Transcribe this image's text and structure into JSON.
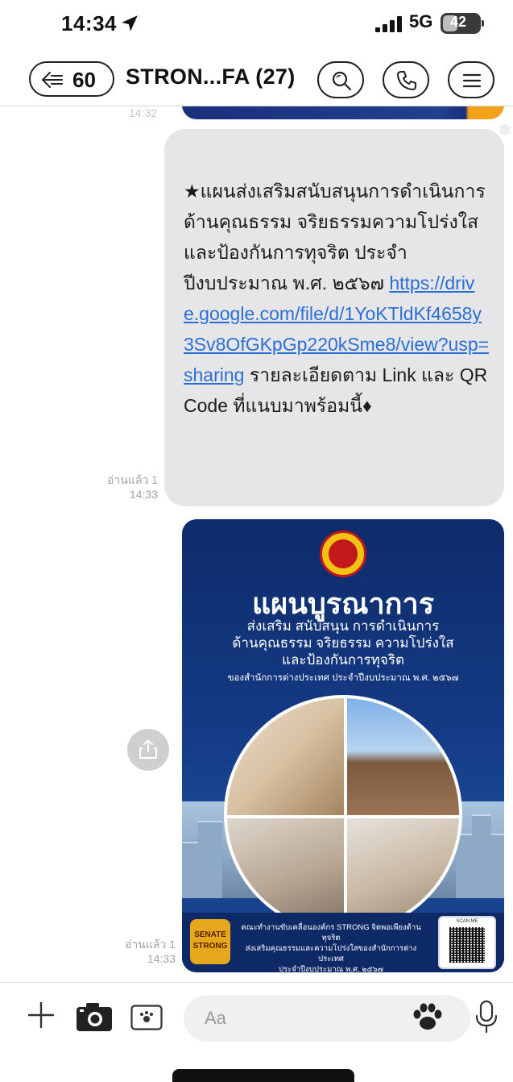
{
  "status_bar": {
    "time": "14:34",
    "network": "5G",
    "battery": "42",
    "battery_level": 0.42
  },
  "header": {
    "back_count": "60",
    "title": "STRON...FA (27)"
  },
  "chat": {
    "previous_time": "14:32",
    "text_message": {
      "text_before": "★แผนส่งเสริมสนับสนุนการดำเนินการด้านคุณธรรม จริยธรรมความโปร่งใสและป้องกันการทุจริต ประจำปีงบประมาณ พ.ศ. ๒๕๖๗ ",
      "link": "https://drive.google.com/file/d/1YoKTldKf4658y3Sv8OfGKpGp220kSme8/view?usp=sharing",
      "text_after": " รายละเอียดตาม Link และ QR Code ที่แนบมาพร้อมนี้♦",
      "read_status": "อ่านแล้ว 1",
      "time": "14:33"
    },
    "image_message": {
      "title": "แผนบูรณาการ",
      "subtitle": "ส่งเสริม สนับสนุน การดำเนินการ\nด้านคุณธรรม จริยธรรม ความโปร่งใส\nและป้องกันการทุจริต",
      "org_line": "ของสำนักการต่างประเทศ ประจำปีงบประมาณ พ.ศ. ๒๕๖๗",
      "logo_text": "SENATE STRONG",
      "footer_text": "คณะทำงานขับเคลื่อนองค์กร STRONG จิตพอเพียงต้านทุจริต\nส่งเสริมคุณธรรมและความโปร่งใสของสำนักการต่างประเทศ\nประจำปีงบประมาณ พ.ศ. ๒๕๖๗",
      "qr_label": "SCAN ME",
      "read_status": "อ่านแล้ว 1",
      "time": "14:33"
    }
  },
  "input_bar": {
    "placeholder": "Aa"
  },
  "icons": {
    "location": "location-arrow-icon",
    "back": "back-arrow-icon",
    "search": "search-icon",
    "call": "phone-icon",
    "menu": "menu-icon",
    "share": "share-icon",
    "plus": "plus-icon",
    "camera": "camera-icon",
    "sticker": "image-icon",
    "paw": "paw-icon",
    "mic": "microphone-icon"
  },
  "colors": {
    "link": "#2a6fd6",
    "bubble": "#e6e6e8",
    "poster_navy": "#0e2b6a"
  }
}
